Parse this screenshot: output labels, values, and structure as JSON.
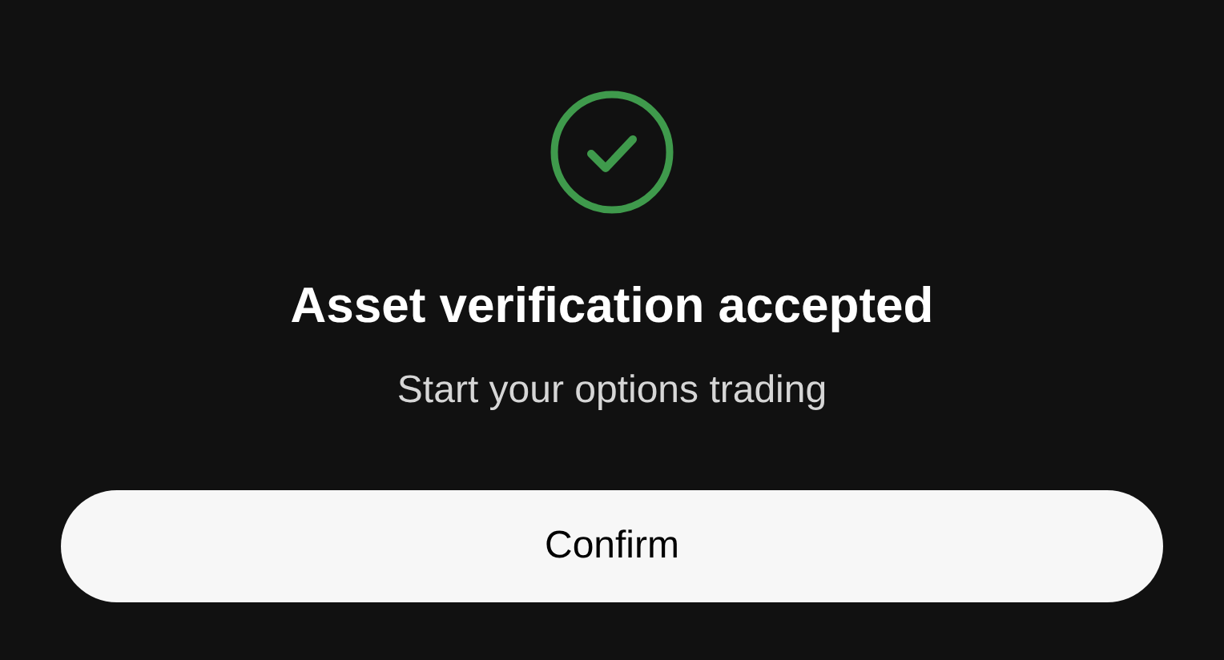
{
  "status": {
    "kind": "success"
  },
  "title": "Asset verification accepted",
  "subtitle": "Start your options trading",
  "buttons": [
    "Confirm"
  ]
}
